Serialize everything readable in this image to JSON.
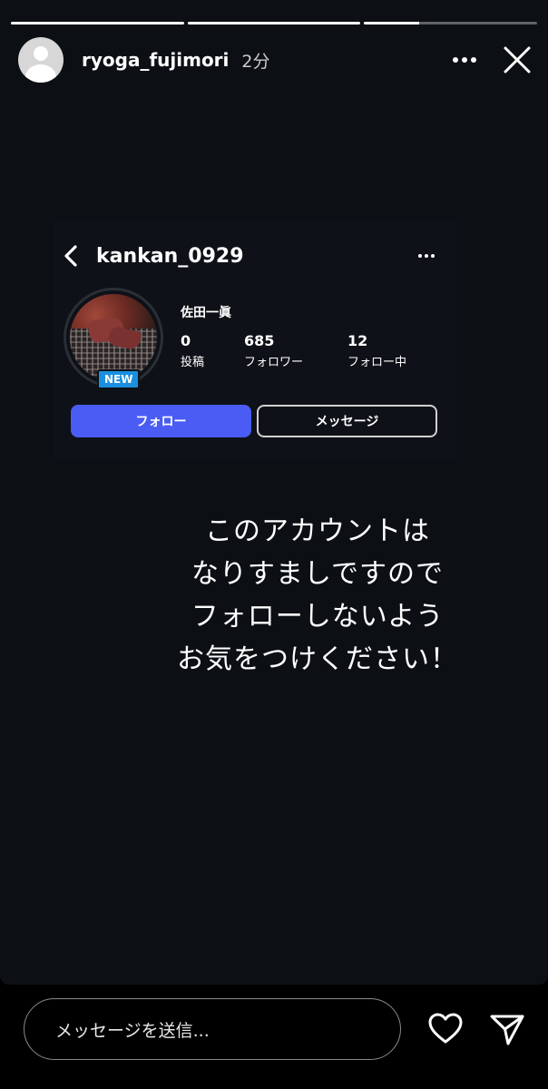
{
  "story": {
    "progress": [
      1.0,
      1.0,
      0.32
    ],
    "user": {
      "username": "ryoga_fujimori",
      "time": "2分"
    },
    "icons": {
      "more": "more-horizontal-icon",
      "close": "close-icon"
    }
  },
  "embedded_profile": {
    "username": "kankan_0929",
    "display_name": "佐田一眞",
    "badge": "NEW",
    "stats": [
      {
        "value": "0",
        "label": "投稿"
      },
      {
        "value": "685",
        "label": "フォロワー"
      },
      {
        "value": "12",
        "label": "フォロー中"
      }
    ],
    "follow_label": "フォロー",
    "message_label": "メッセージ",
    "accent": "#4a5cf3"
  },
  "warning_lines": [
    "このアカウントは",
    "なりすましですので",
    "フォローしないよう",
    "お気をつけください！"
  ],
  "bottom": {
    "reply_placeholder": "メッセージを送信..."
  }
}
